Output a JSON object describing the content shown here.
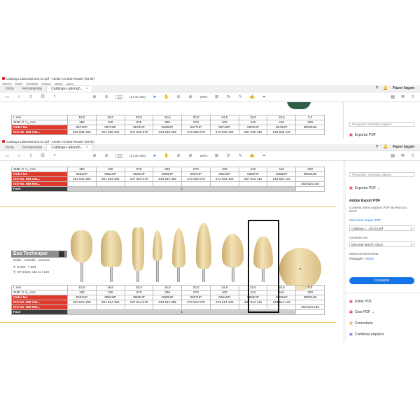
{
  "window_title": "Catalogo-Laboratorio23.24.pdf - Adobe Acrobat Reader (64-bit)",
  "menu": [
    "Arquivo",
    "Editar",
    "Visualizar",
    "Assinar",
    "Janela",
    "Ajuda"
  ],
  "tabs": {
    "home": "Início",
    "tools": "Ferramentas",
    "doc": "Catálogo-Laborató..."
  },
  "signin_label": "Fazer logon",
  "page_field": "23",
  "page_count": "(21 de 190)",
  "zoom": "100%",
  "search_placeholder": "Pesquisar 'Substituir página'",
  "export_pdf": "Exportar PDF",
  "adobe_export": "Adobe Export PDF",
  "export_desc": "Converta online arquivos PDF em Word ou Excel",
  "select_file": "Selecionar arquivo PDF",
  "selected_file": "Catálogo-L...o23.24.pdf",
  "convert_to_label": "Converter em",
  "convert_to_value": "Microsoft Word (*.docx)",
  "doc_lang_label": "Idioma do documento:",
  "doc_lang_value": "Português",
  "doc_lang_change": "Alterar",
  "convert_button": "Converter",
  "tools": [
    "Editar PDF",
    "Criar PDF",
    "Comentário",
    "Combinar arquivos"
  ],
  "brand": {
    "name": "Exa Technique",
    "colors": "Giallo - Amarillo - Amarelo",
    "rpm": "5.000 - 7.000",
    "spec": "HP 6/100, UM 12 / 100"
  },
  "top_table": {
    "rows": [
      {
        "label": "L mm",
        "cells": [
          "16,0",
          "16,0",
          "20,0",
          "15,5",
          "20,0",
          "24,5",
          "18,0",
          "19,5",
          "3,0"
        ]
      },
      {
        "label": "SIZE ∅ ¹/₁₀ mm",
        "cells": [
          "150",
          "150",
          "070",
          "055",
          "070",
          "100",
          "110",
          "110",
          "220"
        ]
      },
      {
        "label": "Order No.",
        "cells": [
          "0671HP",
          "0672HP",
          "0673HP",
          "0669HP",
          "0677HP",
          "0674HP",
          "0675HP",
          "0676HP",
          "BR03UM"
        ]
      },
      {
        "label": "ISO No. 658 104...",
        "cells": [
          "012 536 150",
          "201 536 150",
          "107 536 070",
          "243 536 055",
          "273 536 070",
          "273 536 100",
          "237 536 110",
          "243 536 110",
          ""
        ]
      }
    ]
  },
  "mid_table": {
    "rows": [
      {
        "label": "SIZE ∅ ¹/₁₀ mm",
        "cells": [
          "150",
          "150",
          "070",
          "055",
          "070",
          "100",
          "110",
          "110",
          "220"
        ]
      },
      {
        "label": "Order No.",
        "cells": [
          "0661HP",
          "0662HP",
          "0663HP",
          "0669HP",
          "0667HP",
          "0664HP",
          "0665HP",
          "0666HP",
          "BR02UM"
        ]
      },
      {
        "label": "ISO No. 658 104...",
        "cells": [
          "012 534 150",
          "201 534 150",
          "107 534 070",
          "243 534 055",
          "273 534 070",
          "273 534 100",
          "237 534 110",
          "243 534 110",
          ""
        ]
      },
      {
        "label": "ISO No. 658 900...",
        "cells": [
          "",
          "",
          "",
          "",
          "",
          "",
          "",
          "",
          "303 534 220"
        ]
      },
      {
        "label": "Fase",
        "cells": [
          "",
          "",
          "",
          "",
          "",
          "",
          "",
          "",
          "2"
        ]
      }
    ]
  },
  "bottom_table": {
    "rows": [
      {
        "label": "L mm",
        "cells": [
          "16,0",
          "16,0",
          "20,0",
          "15,5",
          "20,0",
          "24,5",
          "18,0",
          "19,5",
          "3,0"
        ]
      },
      {
        "label": "SIZE ∅ ¹/₁₀ mm",
        "cells": [
          "150",
          "150",
          "070",
          "055",
          "070",
          "100",
          "110",
          "110",
          "220"
        ]
      },
      {
        "label": "Order No.",
        "cells": [
          "0651HP",
          "0652HP",
          "0653HP",
          "0659HP",
          "0657HP",
          "0654HP",
          "0655HP",
          "0656HP",
          "BR01UM"
        ]
      },
      {
        "label": "ISO No. 658 104...",
        "cells": [
          "012 514 150",
          "201 514 150",
          "107 514 070",
          "243 514 055",
          "273 514 070",
          "273 514 100",
          "237 514 110",
          "243 514 110",
          ""
        ]
      },
      {
        "label": "ISO No. 658 900...",
        "cells": [
          "",
          "",
          "",
          "",
          "",
          "",
          "",
          "",
          "303 514 220"
        ]
      },
      {
        "label": "Fase",
        "cells": [
          "",
          "",
          "",
          "",
          "",
          "",
          "",
          "",
          "3"
        ]
      }
    ]
  }
}
